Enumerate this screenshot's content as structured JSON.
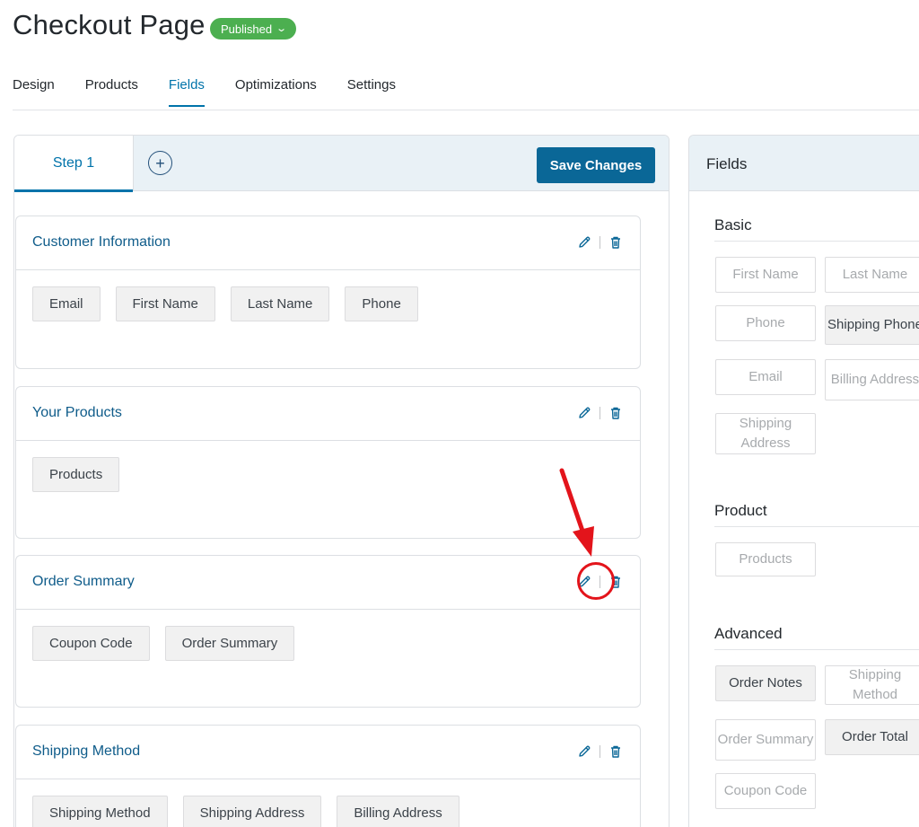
{
  "header": {
    "title": "Checkout Page",
    "status": "Published"
  },
  "tabs": [
    "Design",
    "Products",
    "Fields",
    "Optimizations",
    "Settings"
  ],
  "builder": {
    "step_label": "Step 1",
    "add_step_symbol": "+",
    "save_label": "Save Changes",
    "sections": [
      {
        "title": "Customer Information",
        "fields": [
          "Email",
          "First Name",
          "Last Name",
          "Phone"
        ]
      },
      {
        "title": "Your Products",
        "fields": [
          "Products"
        ]
      },
      {
        "title": "Order Summary",
        "fields": [
          "Coupon Code",
          "Order Summary"
        ]
      },
      {
        "title": "Shipping Method",
        "fields": [
          "Shipping Method",
          "Shipping Address",
          "Billing Address"
        ]
      }
    ]
  },
  "fields_panel": {
    "title": "Fields",
    "groups": [
      {
        "name": "Basic",
        "items": [
          {
            "label": "First Name",
            "used": false
          },
          {
            "label": "Last Name",
            "used": false
          },
          {
            "label": "Phone",
            "used": false
          },
          {
            "label": "Shipping Phone",
            "used": true
          },
          {
            "label": "Email",
            "used": false
          },
          {
            "label": "Billing Address",
            "used": false
          },
          {
            "label": "Shipping Address",
            "used": false
          }
        ]
      },
      {
        "name": "Product",
        "items": [
          {
            "label": "Products",
            "used": false
          }
        ]
      },
      {
        "name": "Advanced",
        "items": [
          {
            "label": "Order Notes",
            "used": true
          },
          {
            "label": "Shipping Method",
            "used": false
          },
          {
            "label": "Order Summary",
            "used": false
          },
          {
            "label": "Order Total",
            "used": true
          },
          {
            "label": "Coupon Code",
            "used": false
          }
        ]
      }
    ]
  },
  "colors": {
    "accent": "#0073aa",
    "badge": "#4caf50",
    "save_button": "#0a6797",
    "annotation": "#e3141b"
  },
  "icons": {
    "edit": "pencil-icon",
    "delete": "trash-icon",
    "annotation": "red-arrow-icon"
  }
}
